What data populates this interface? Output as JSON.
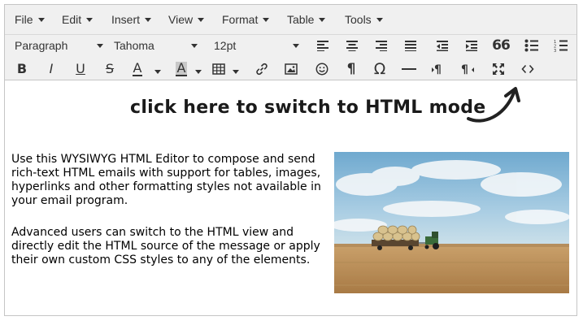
{
  "menubar": {
    "file": "File",
    "edit": "Edit",
    "insert": "Insert",
    "view": "View",
    "format": "Format",
    "table": "Table",
    "tools": "Tools"
  },
  "toolbar": {
    "block_format": "Paragraph",
    "font_family": "Tahoma",
    "font_size": "12pt",
    "bold": "B",
    "italic": "I",
    "underline": "U",
    "strikethrough": "S",
    "text_color": "A",
    "background_color": "A",
    "blockquote": "66",
    "pilcrow": "¶",
    "omega": "Ω"
  },
  "icons": [
    "align-left-icon",
    "align-center-icon",
    "align-right-icon",
    "align-justify-icon",
    "outdent-icon",
    "indent-icon",
    "blockquote-icon",
    "bullet-list-icon",
    "numbered-list-icon",
    "table-icon",
    "link-icon",
    "image-icon",
    "emoticon-icon",
    "nonbreaking-icon",
    "special-char-icon",
    "horizontal-rule-icon",
    "ltr-icon",
    "rtl-icon",
    "fullscreen-icon",
    "source-code-icon"
  ],
  "colors": {
    "toolbar_bg": "#f0f0f0",
    "border": "#c5c5c5",
    "text": "#333333"
  },
  "callout": "click here to switch to HTML mode",
  "content": {
    "paragraph1": "Use this WYSIWYG HTML Editor to compose and send rich-text HTML emails with support for tables, images, hyperlinks and other formatting styles not available in your email program.",
    "paragraph2": "Advanced users can switch to the HTML view and directly edit the HTML source of the message or apply their own custom CSS styles to any of the elements."
  }
}
